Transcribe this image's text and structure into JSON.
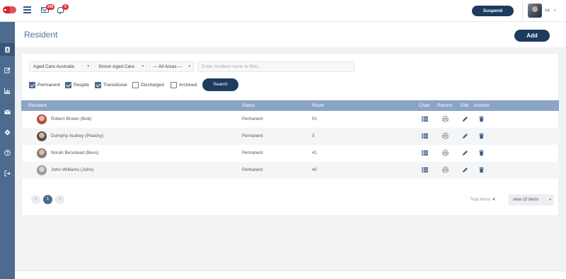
{
  "header": {
    "mail_count": "240",
    "notification_count": "0",
    "suspend_label": "Suspend",
    "user_name": "sa",
    "user_caret": "▾"
  },
  "sidebar": {
    "items": [
      {
        "icon": "resident-icon",
        "active": true
      },
      {
        "icon": "edit-icon",
        "active": false
      },
      {
        "icon": "bar-chart-icon",
        "active": false
      },
      {
        "icon": "mail-icon",
        "active": false
      },
      {
        "icon": "gear-icon",
        "active": false
      },
      {
        "icon": "help-icon",
        "active": false
      },
      {
        "icon": "logout-icon",
        "active": false
      }
    ]
  },
  "page": {
    "title": "Resident",
    "add_label": "Add"
  },
  "filters": {
    "organisation": "Aged Care Australia",
    "facility": "Simon Aged Care",
    "area": "--- All Areas ---",
    "caret": "▾",
    "name_placeholder": "Enter resident name to filter...",
    "checkboxes": [
      {
        "label": "Permanent",
        "checked": true
      },
      {
        "label": "Respite",
        "checked": true
      },
      {
        "label": "Transitional",
        "checked": true
      },
      {
        "label": "Discharged",
        "checked": false
      },
      {
        "label": "Archived",
        "checked": false
      }
    ],
    "search_label": "Search"
  },
  "table": {
    "columns": {
      "resident": "Resident",
      "status": "Status",
      "room": "Room",
      "chart": "Chart",
      "record": "Record",
      "edit": "Edit",
      "archive": "Archive"
    },
    "rows": [
      {
        "name": "Robert Brown (Bob)",
        "status": "Permanent",
        "room": "01"
      },
      {
        "name": "Dumphy Audrey (Peachy)",
        "status": "Permanent",
        "room": "3"
      },
      {
        "name": "Norah Benstead (Bess)",
        "status": "Permanent",
        "room": "41"
      },
      {
        "name": "John Williams (John)",
        "status": "Permanent",
        "room": "40"
      }
    ]
  },
  "pagination": {
    "prev": "‹",
    "current": "1",
    "next": "›",
    "total_label": "Total Items:",
    "total_value": "4",
    "per_page": "view 10 items",
    "caret": "▾"
  },
  "colors": {
    "brand_dark": "#1d3a5f",
    "sidebar": "#4d6a8f",
    "table_header": "#8aa5c4",
    "badge": "#e0323a"
  }
}
